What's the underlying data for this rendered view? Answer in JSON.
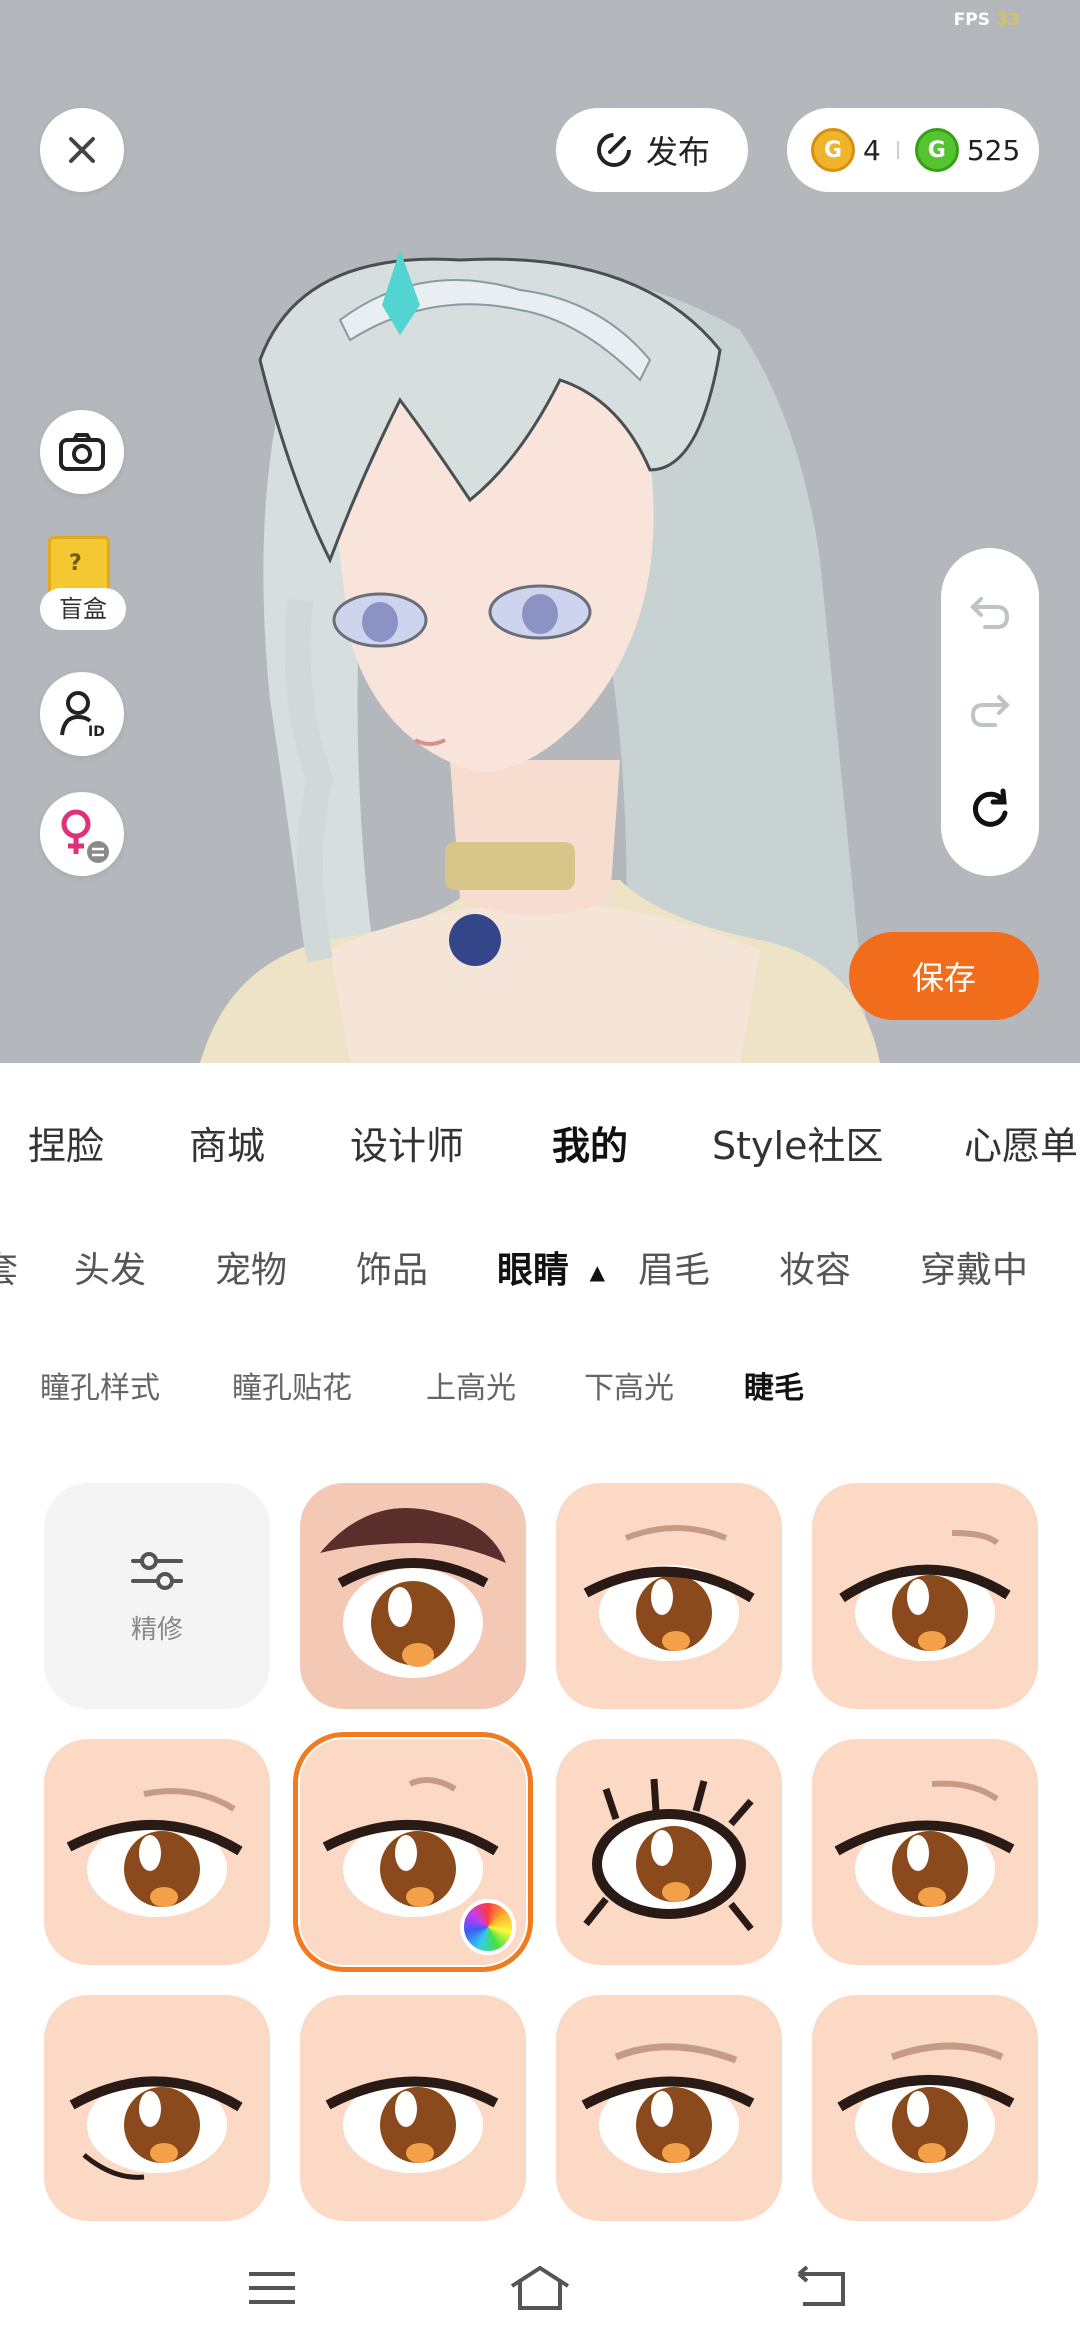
{
  "status": {
    "fps_label": "FPS",
    "fps_value": "33"
  },
  "header": {
    "publish_label": "发布",
    "gold_coins": "4",
    "green_coins": "525",
    "gold_coin_icon": "G",
    "green_coin_icon": "G"
  },
  "left_tools": {
    "blindbox_label": "盲盒",
    "blindbox_icon": "?"
  },
  "save_label": "保存",
  "main_tabs": [
    {
      "label": "捏脸",
      "active": false
    },
    {
      "label": "商城",
      "active": false
    },
    {
      "label": "设计师",
      "active": false
    },
    {
      "label": "我的",
      "active": true
    },
    {
      "label": "Style社区",
      "active": false
    },
    {
      "label": "心愿单",
      "active": false
    }
  ],
  "category_tabs": [
    {
      "label": "套",
      "active": false
    },
    {
      "label": "头发",
      "active": false
    },
    {
      "label": "宠物",
      "active": false
    },
    {
      "label": "饰品",
      "active": false
    },
    {
      "label": "眼睛",
      "active": true
    },
    {
      "label": "眉毛",
      "active": false
    },
    {
      "label": "妆容",
      "active": false
    },
    {
      "label": "穿戴中",
      "active": false
    }
  ],
  "sub_tabs": [
    {
      "label": "瞳孔样式",
      "active": false
    },
    {
      "label": "瞳孔贴花",
      "active": false
    },
    {
      "label": "上高光",
      "active": false
    },
    {
      "label": "下高光",
      "active": false
    },
    {
      "label": "睫毛",
      "active": true
    }
  ],
  "grid": {
    "refine_label": "精修",
    "selected_index": 5,
    "item_count": 11
  },
  "colors": {
    "accent": "#f26d1b",
    "stage_bg": "#b4b7bc",
    "tile_bg": "#fbd9c5",
    "selected_outline": "#f27a1f"
  }
}
